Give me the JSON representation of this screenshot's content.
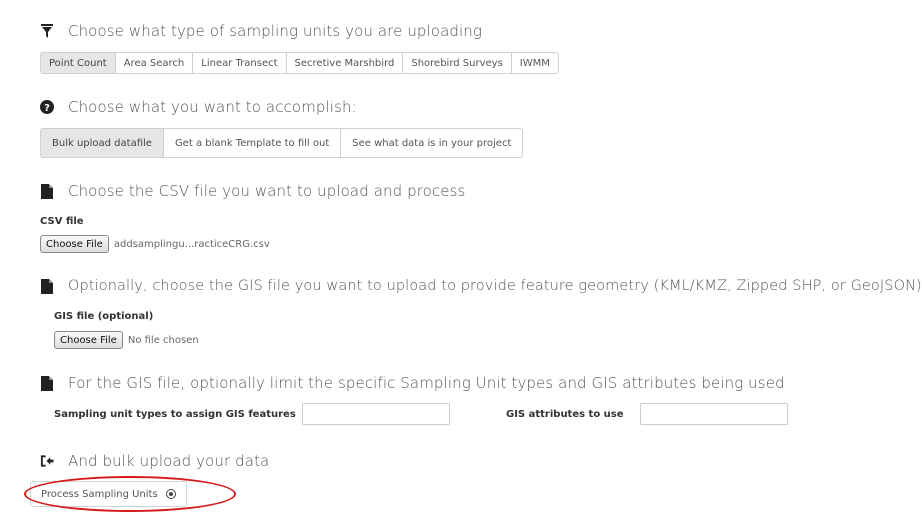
{
  "sections": {
    "type": {
      "title": "Choose what type of sampling units you are uploading",
      "icon": "filter-icon",
      "options": [
        "Point Count",
        "Area Search",
        "Linear Transect",
        "Secretive Marshbird",
        "Shorebird Surveys",
        "IWMM"
      ],
      "selected": "Point Count"
    },
    "goal": {
      "title": "Choose what you want to accomplish:",
      "icon": "question-circle-icon",
      "options": [
        "Bulk upload datafile",
        "Get a blank Template to fill out",
        "See what data is in your project"
      ],
      "selected": "Bulk upload datafile"
    },
    "csv": {
      "title": "Choose the CSV file you want to upload and process",
      "icon": "file-icon",
      "label": "CSV file",
      "button": "Choose File",
      "filename": "addsamplingu...racticeCRG.csv"
    },
    "gis": {
      "title": "Optionally, choose the GIS file you want to upload to provide feature geometry (KML/KMZ, Zipped SHP, or GeoJSON)",
      "icon": "file-icon",
      "label": "GIS file (optional)",
      "button": "Choose File",
      "filename": "No file chosen"
    },
    "limit": {
      "title": "For the GIS file, optionally limit the specific Sampling Unit types and GIS attributes being used",
      "icon": "file-icon",
      "types_label": "Sampling unit types to assign GIS features",
      "types_value": "",
      "attrs_label": "GIS attributes to use",
      "attrs_value": ""
    },
    "upload": {
      "title": "And bulk upload your data",
      "icon": "import-icon",
      "button": "Process Sampling Units",
      "button_icon": "record-circle-icon"
    }
  },
  "colors": {
    "highlight": "#d61a1a",
    "active_button": "#e6e6e6",
    "border": "#d0d0d0"
  }
}
